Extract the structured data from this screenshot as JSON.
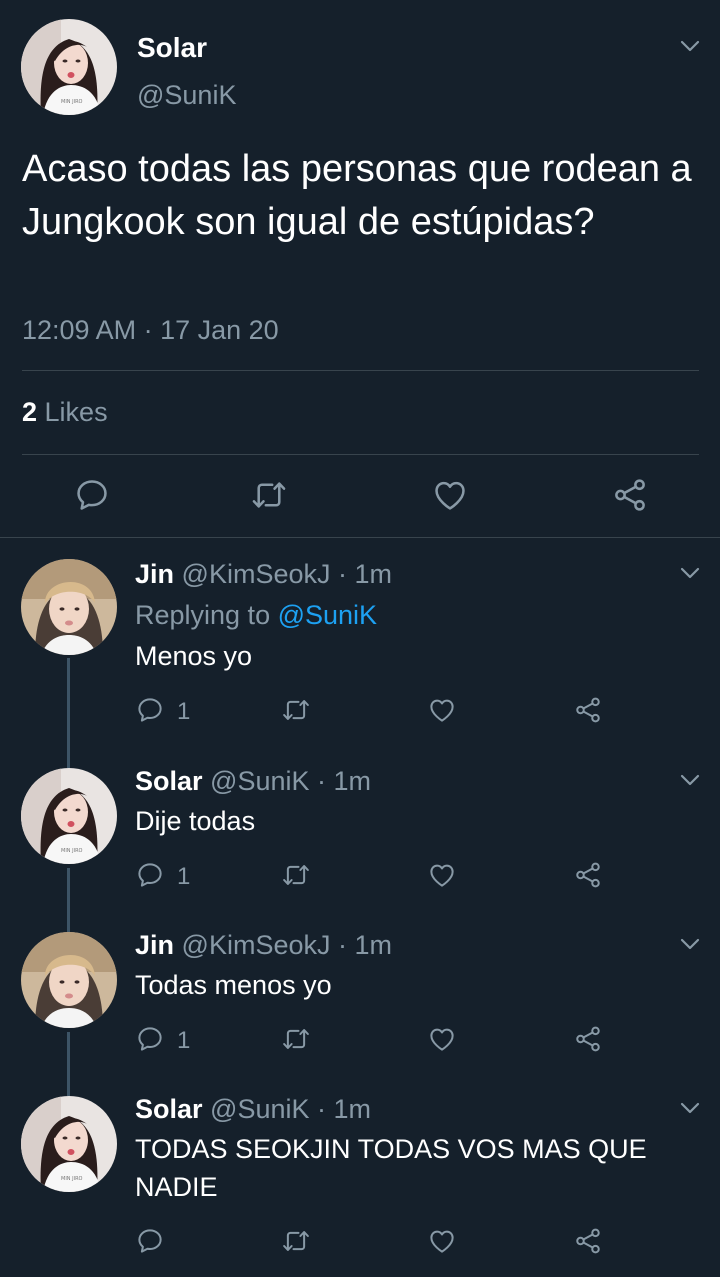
{
  "main_tweet": {
    "name": "Solar",
    "handle": "@SuniK",
    "text": "Acaso todas las personas que rodean a Jungkook son igual de estúpidas?",
    "timestamp": "12:09 AM · 17 Jan 20",
    "likes_count": "2",
    "likes_label": " Likes"
  },
  "replies": [
    {
      "name": "Jin",
      "handle": "@KimSeokJ",
      "time": "· 1m",
      "replying_prefix": "Replying to ",
      "replying_handle": "@SuniK",
      "text": "Menos yo",
      "reply_count": "1"
    },
    {
      "name": "Solar",
      "handle": "@SuniK",
      "time": "· 1m",
      "text": "Dije todas",
      "reply_count": "1"
    },
    {
      "name": "Jin",
      "handle": "@KimSeokJ",
      "time": "· 1m",
      "text": "Todas menos yo",
      "reply_count": "1"
    },
    {
      "name": "Solar",
      "handle": "@SuniK",
      "time": "· 1m",
      "text": "TODAS SEOKJIN TODAS VOS MAS QUE NADIE",
      "reply_count": ""
    }
  ],
  "icons": [
    "reply-icon",
    "retweet-icon",
    "like-icon",
    "share-icon",
    "chevron-down-icon"
  ],
  "colors": {
    "background": "#15202b",
    "secondary_text": "#8899a6",
    "link": "#1da1f2",
    "divider": "#38444d",
    "thread_line": "#3d5466"
  }
}
